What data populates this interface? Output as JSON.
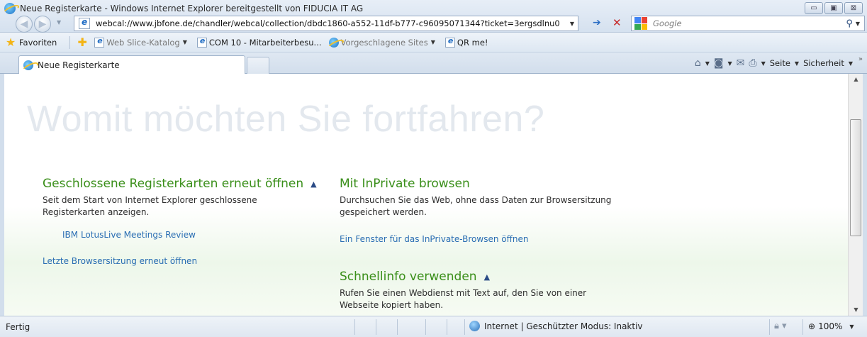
{
  "window": {
    "title": "Neue Registerkarte - Windows Internet Explorer bereitgestellt von FIDUCIA IT AG",
    "controls": {
      "minimize": "▭",
      "maximize": "▣",
      "close": "⊠"
    }
  },
  "nav": {
    "back_icon": "back-arrow-icon",
    "forward_icon": "forward-arrow-icon",
    "address": "webcal://www.jbfone.de/chandler/webcal/collection/dbdc1860-a552-11df-b777-c96095071344?ticket=3ergsdlnu0",
    "search_placeholder": "Google"
  },
  "favorites": {
    "label": "Favoriten",
    "items": [
      {
        "label": "Web Slice-Katalog",
        "dropdown": true,
        "muted": true
      },
      {
        "label": "COM 10 - Mitarbeiterbesu...",
        "dropdown": false,
        "muted": false
      },
      {
        "label": "Vorgeschlagene Sites",
        "dropdown": true,
        "muted": true
      },
      {
        "label": "QR me!",
        "dropdown": false,
        "muted": false
      }
    ]
  },
  "tabs": {
    "active_label": "Neue Registerkarte"
  },
  "command_bar": {
    "page_label": "Seite",
    "security_label": "Sicherheit"
  },
  "content": {
    "hero": "Womit möchten Sie fortfahren?",
    "closed_tabs": {
      "title": "Geschlossene Registerkarten erneut öffnen",
      "description": "Seit dem Start von Internet Explorer geschlossene Registerkarten anzeigen.",
      "item": "IBM LotusLive Meetings Review",
      "reopen_session": "Letzte Browsersitzung erneut öffnen"
    },
    "inprivate": {
      "title": "Mit InPrivate browsen",
      "description": "Durchsuchen Sie das Web, ohne dass Daten zur Browsersitzung gespeichert werden.",
      "link": "Ein Fenster für das InPrivate-Browsen öffnen"
    },
    "accelerators": {
      "title": "Schnellinfo verwenden",
      "description": "Rufen Sie einen Webdienst mit Text auf, den Sie von einer Webseite kopiert haben."
    }
  },
  "status": {
    "text": "Fertig",
    "zone": "Internet | Geschützter Modus: Inaktiv",
    "zoom": "100%"
  },
  "colors": {
    "section_title": "#3a8f1a",
    "link": "#2a6eb3",
    "hero_text": "#e3e8ee"
  }
}
